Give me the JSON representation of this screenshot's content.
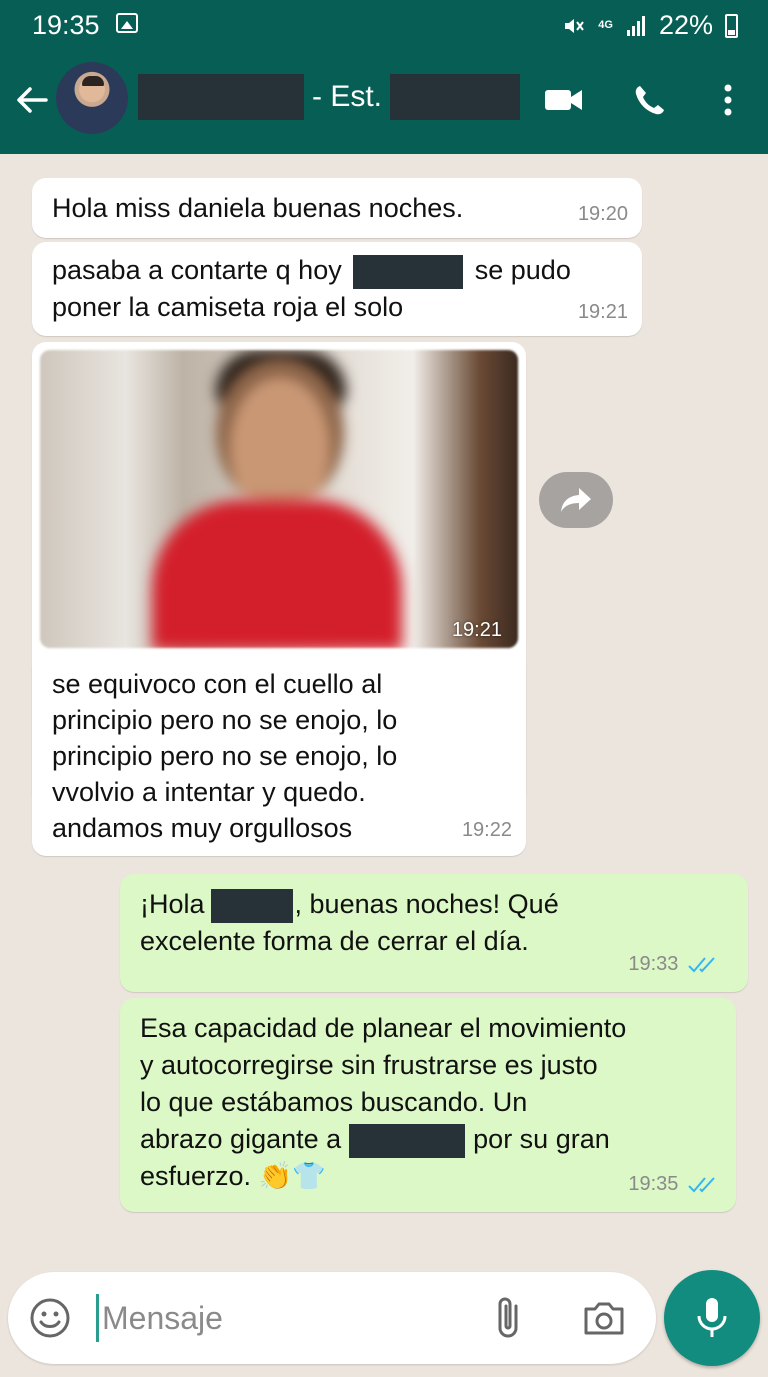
{
  "status_bar": {
    "time": "19:35",
    "network": "4G",
    "battery": "22%"
  },
  "header": {
    "title_separator": "- Est.",
    "icons": [
      "back-arrow-icon",
      "video-call-icon",
      "voice-call-icon",
      "more-options-icon"
    ]
  },
  "messages": [
    {
      "direction": "in",
      "text": "Hola miss daniela buenas noches.",
      "time": "19:20"
    },
    {
      "direction": "in",
      "text_before": "pasaba a contarte q hoy",
      "text_after": "se pudo",
      "text_line2": "poner la camiseta roja el solo",
      "time": "19:21"
    },
    {
      "direction": "in",
      "type": "image",
      "time": "19:21"
    },
    {
      "direction": "in",
      "lines": [
        "se equivoco con el cuello al",
        "principio pero no se enojo, lo",
        "principio pero no se enojo, lo",
        "vvolvio a intentar y quedo.",
        "andamos muy orgullosos"
      ],
      "time": "19:22"
    },
    {
      "direction": "out",
      "text_before": "¡Hola",
      "text_after": ", buenas noches! Qué",
      "text_line2": "excelente forma de cerrar el día.",
      "time": "19:33",
      "status": "read"
    },
    {
      "direction": "out",
      "lines": [
        "Esa capacidad de planear el movimiento",
        "y autocorregirse sin frustrarse es justo",
        "lo que estábamos  buscando. Un"
      ],
      "line4_before": "abrazo gigante a",
      "line4_after": "por su gran",
      "line5": "esfuerzo. 👏👕",
      "time": "19:35",
      "status": "read"
    }
  ],
  "composer": {
    "placeholder": "Mensaje"
  },
  "colors": {
    "header": "#075e54",
    "outgoing_bubble": "#dcf8c6",
    "incoming_bubble": "#ffffff",
    "read_ticks": "#34b7f1",
    "mic_button": "#128c7e"
  }
}
